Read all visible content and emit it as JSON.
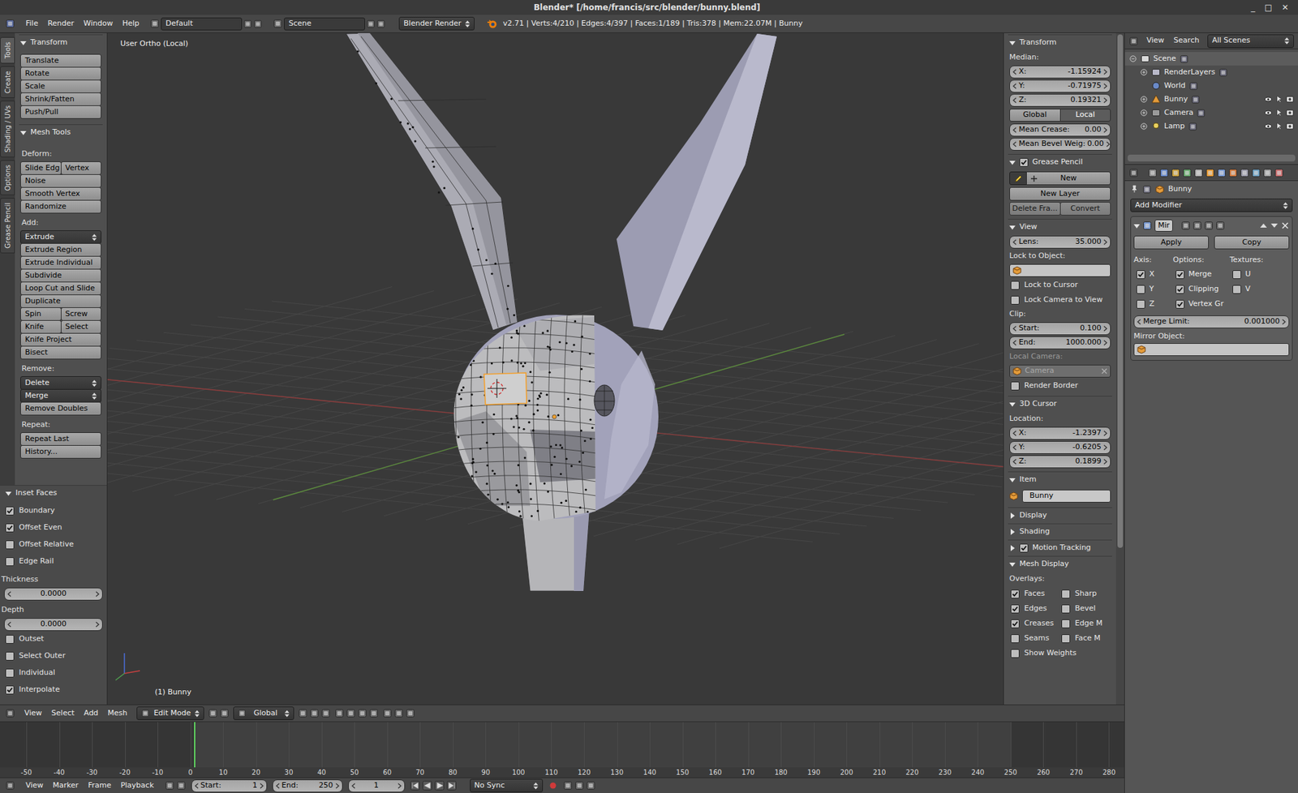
{
  "window": {
    "title": "Blender* [/home/francis/src/blender/bunny.blend]",
    "controls": [
      "_",
      "□",
      "✕"
    ]
  },
  "info_header": {
    "menus": [
      "File",
      "Render",
      "Window",
      "Help"
    ],
    "layout": "Default",
    "scene": "Scene",
    "engine": "Blender Render",
    "stats": "v2.71 | Verts:4/210 | Edges:4/397 | Faces:1/189 | Tris:378 | Mem:22.07M | Bunny"
  },
  "tool_shelf": {
    "tabs": [
      {
        "label": "Tools",
        "selected": true
      },
      {
        "label": "Create",
        "selected": false
      },
      {
        "label": "Shading / UVs",
        "selected": false
      },
      {
        "label": "Options",
        "selected": false
      },
      {
        "label": "Grease Pencil",
        "selected": false
      }
    ],
    "panels": [
      {
        "title": "Transform",
        "expanded": true,
        "rows": [
          {
            "kind": "buttons",
            "labels": [
              "Translate"
            ]
          },
          {
            "kind": "buttons",
            "labels": [
              "Rotate"
            ]
          },
          {
            "kind": "buttons",
            "labels": [
              "Scale"
            ]
          },
          {
            "kind": "buttons",
            "labels": [
              "Shrink/Fatten"
            ]
          },
          {
            "kind": "buttons",
            "labels": [
              "Push/Pull"
            ]
          }
        ]
      },
      {
        "title": "Mesh Tools",
        "expanded": true,
        "rows": [
          {
            "kind": "label",
            "text": "Deform:"
          },
          {
            "kind": "buttons",
            "labels": [
              "Slide Edg",
              "Vertex"
            ]
          },
          {
            "kind": "buttons",
            "labels": [
              "Noise"
            ]
          },
          {
            "kind": "buttons",
            "labels": [
              "Smooth Vertex"
            ]
          },
          {
            "kind": "buttons",
            "labels": [
              "Randomize"
            ]
          },
          {
            "kind": "label",
            "text": "Add:"
          },
          {
            "kind": "menu",
            "text": "Extrude"
          },
          {
            "kind": "buttons",
            "labels": [
              "Extrude Region"
            ]
          },
          {
            "kind": "buttons",
            "labels": [
              "Extrude Individual"
            ]
          },
          {
            "kind": "buttons",
            "labels": [
              "Subdivide"
            ]
          },
          {
            "kind": "buttons",
            "labels": [
              "Loop Cut and Slide"
            ]
          },
          {
            "kind": "buttons",
            "labels": [
              "Duplicate"
            ]
          },
          {
            "kind": "buttons",
            "labels": [
              "Spin",
              "Screw"
            ]
          },
          {
            "kind": "buttons",
            "labels": [
              "Knife",
              "Select"
            ]
          },
          {
            "kind": "buttons",
            "labels": [
              "Knife Project"
            ]
          },
          {
            "kind": "buttons",
            "labels": [
              "Bisect"
            ]
          },
          {
            "kind": "label",
            "text": "Remove:"
          },
          {
            "kind": "menu",
            "text": "Delete"
          },
          {
            "kind": "menu",
            "text": "Merge"
          },
          {
            "kind": "buttons",
            "labels": [
              "Remove Doubles"
            ]
          },
          {
            "kind": "label",
            "text": "Repeat:"
          },
          {
            "kind": "buttons",
            "labels": [
              "Repeat Last"
            ]
          },
          {
            "kind": "buttons",
            "labels": [
              "History..."
            ]
          }
        ]
      }
    ],
    "operator": {
      "title": "Inset Faces",
      "expanded": true,
      "rows": [
        {
          "kind": "check",
          "label": "Boundary",
          "checked": true
        },
        {
          "kind": "check",
          "label": "Offset Even",
          "checked": true
        },
        {
          "kind": "check",
          "label": "Offset Relative",
          "checked": false
        },
        {
          "kind": "check",
          "label": "Edge Rail",
          "checked": false
        },
        {
          "kind": "label",
          "text": "Thickness"
        },
        {
          "kind": "number",
          "value": "0.0000"
        },
        {
          "kind": "label",
          "text": "Depth"
        },
        {
          "kind": "number",
          "value": "0.0000"
        },
        {
          "kind": "check",
          "label": "Outset",
          "checked": false
        },
        {
          "kind": "check",
          "label": "Select Outer",
          "checked": false
        },
        {
          "kind": "check",
          "label": "Individual",
          "checked": false
        },
        {
          "kind": "check",
          "label": "Interpolate",
          "checked": true
        }
      ]
    }
  },
  "viewport": {
    "view_label": "User Ortho (Local)",
    "object_label": "(1) Bunny"
  },
  "viewport_header": {
    "menus": [
      "View",
      "Select",
      "Add",
      "Mesh"
    ],
    "mode": "Edit Mode",
    "orientation": "Global"
  },
  "n_panel": {
    "panels": [
      {
        "title": "Transform",
        "expanded": true,
        "rows": [
          {
            "kind": "label",
            "text": "Median:"
          },
          {
            "kind": "field",
            "label": "X:",
            "value": "-1.15924"
          },
          {
            "kind": "field",
            "label": "Y:",
            "value": "-0.71975"
          },
          {
            "kind": "field",
            "label": "Z:",
            "value": "0.19321"
          },
          {
            "kind": "toggle",
            "options": [
              {
                "label": "Global",
                "selected": false
              },
              {
                "label": "Local",
                "selected": true
              }
            ]
          },
          {
            "kind": "field",
            "label": "Mean Crease:",
            "value": "0.00"
          },
          {
            "kind": "field",
            "label": "Mean Bevel Weig:",
            "value": "0.00"
          }
        ]
      },
      {
        "title": "Grease Pencil",
        "expanded": true,
        "checked": true,
        "rows": [
          {
            "kind": "new",
            "label": "New"
          },
          {
            "kind": "buttons",
            "labels": [
              "New Layer"
            ],
            "disabled": false
          },
          {
            "kind": "buttons",
            "labels": [
              "Delete Fra...",
              "Convert"
            ],
            "disabled": true
          }
        ]
      },
      {
        "title": "View",
        "expanded": true,
        "rows": [
          {
            "kind": "field",
            "label": "Lens:",
            "value": "35.000"
          },
          {
            "kind": "label",
            "text": "Lock to Object:",
            "disabled": false
          },
          {
            "kind": "object",
            "value": "",
            "disabled": false
          },
          {
            "kind": "check",
            "label": "Lock to Cursor",
            "checked": false
          },
          {
            "kind": "check",
            "label": "Lock Camera to View",
            "checked": false
          },
          {
            "kind": "label",
            "text": "Clip:",
            "disabled": false
          },
          {
            "kind": "field",
            "label": "Start:",
            "value": "0.100"
          },
          {
            "kind": "field",
            "label": "End:",
            "value": "1000.000"
          },
          {
            "kind": "label",
            "text": "Local Camera:",
            "disabled": true
          },
          {
            "kind": "object",
            "value": "Camera",
            "disabled": true
          },
          {
            "kind": "check",
            "label": "Render Border",
            "checked": false
          }
        ]
      },
      {
        "title": "3D Cursor",
        "expanded": true,
        "rows": [
          {
            "kind": "label",
            "text": "Location:"
          },
          {
            "kind": "field",
            "label": "X:",
            "value": "-1.2397"
          },
          {
            "kind": "field",
            "label": "Y:",
            "value": "-0.6205"
          },
          {
            "kind": "field",
            "label": "Z:",
            "value": "0.1899"
          }
        ]
      },
      {
        "title": "Item",
        "expanded": true,
        "rows": [
          {
            "kind": "name",
            "value": "Bunny"
          }
        ]
      },
      {
        "title": "Display",
        "expanded": false,
        "rows": []
      },
      {
        "title": "Shading",
        "expanded": false,
        "rows": []
      },
      {
        "title": "Motion Tracking",
        "expanded": false,
        "checked": true,
        "rows": []
      },
      {
        "title": "Mesh Display",
        "expanded": true,
        "rows": [
          {
            "kind": "label",
            "text": "Overlays:"
          },
          {
            "kind": "checkgrid",
            "items": [
              {
                "label": "Faces",
                "checked": true
              },
              {
                "label": "Sharp",
                "checked": false
              },
              {
                "label": "Edges",
                "checked": true
              },
              {
                "label": "Bevel",
                "checked": false
              },
              {
                "label": "Creases",
                "checked": true
              },
              {
                "label": "Edge M",
                "checked": false
              },
              {
                "label": "Seams",
                "checked": false
              },
              {
                "label": "Face M",
                "checked": false
              }
            ]
          },
          {
            "kind": "check",
            "label": "Show Weights",
            "checked": false
          }
        ]
      }
    ]
  },
  "outliner": {
    "menus": [
      "View",
      "Search"
    ],
    "filter": "All Scenes",
    "items": [
      {
        "label": "Scene",
        "kind": "scene",
        "depth": 0,
        "expander": "open",
        "restrict": false,
        "selected": true
      },
      {
        "label": "RenderLayers",
        "kind": "renderlayers",
        "depth": 1,
        "expander": "closed",
        "restrict": false,
        "selected": false
      },
      {
        "label": "World",
        "kind": "world",
        "depth": 1,
        "expander": "none",
        "restrict": false,
        "selected": false
      },
      {
        "label": "Bunny",
        "kind": "mesh",
        "depth": 1,
        "expander": "closed",
        "restrict": true,
        "selected": false
      },
      {
        "label": "Camera",
        "kind": "camera",
        "depth": 1,
        "expander": "closed",
        "restrict": true,
        "selected": false
      },
      {
        "label": "Lamp",
        "kind": "lamp",
        "depth": 1,
        "expander": "closed",
        "restrict": true,
        "selected": false
      }
    ]
  },
  "properties": {
    "breadcrumb": "Bunny",
    "add_modifier": "Add Modifier",
    "modifier": {
      "name": "Mir",
      "expanded": true,
      "buttons": [
        "Apply",
        "Copy"
      ],
      "columns": [
        {
          "title": "Axis:",
          "items": [
            {
              "label": "X",
              "checked": true
            },
            {
              "label": "Y",
              "checked": false
            },
            {
              "label": "Z",
              "checked": false
            }
          ]
        },
        {
          "title": "Options:",
          "items": [
            {
              "label": "Merge",
              "checked": true
            },
            {
              "label": "Clipping",
              "checked": true
            },
            {
              "label": "Vertex Gr",
              "checked": true
            }
          ]
        },
        {
          "title": "Textures:",
          "items": [
            {
              "label": "U",
              "checked": false
            },
            {
              "label": "V",
              "checked": false
            }
          ]
        }
      ],
      "merge_limit": {
        "label": "Merge Limit:",
        "value": "0.001000"
      },
      "mirror_object_label": "Mirror Object:"
    }
  },
  "timeline": {
    "ruler": [
      "-50",
      "-40",
      "-30",
      "-20",
      "-10",
      "0",
      "10",
      "20",
      "30",
      "40",
      "50",
      "60",
      "70",
      "80",
      "90",
      "100",
      "110",
      "120",
      "130",
      "140",
      "150",
      "160",
      "170",
      "180",
      "190",
      "200",
      "210",
      "220",
      "230",
      "240",
      "250",
      "260",
      "270",
      "280"
    ],
    "menus": [
      "View",
      "Marker",
      "Frame",
      "Playback"
    ],
    "start_label": "Start:",
    "start": "1",
    "end_label": "End:",
    "end": "250",
    "current": "1",
    "sync": "No Sync"
  }
}
